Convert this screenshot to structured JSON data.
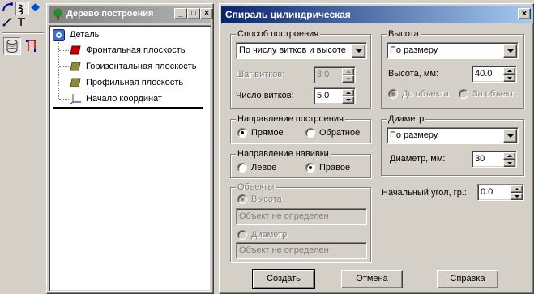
{
  "tree_panel": {
    "title": "Дерево построения",
    "root": "Деталь",
    "items": [
      {
        "label": "Фронтальная плоскость",
        "color": "#c00000"
      },
      {
        "label": "Горизонтальная плоскость",
        "color": "#8b8b38"
      },
      {
        "label": "Профильная плоскость",
        "color": "#8b8b38"
      },
      {
        "label": "Начало координат"
      }
    ]
  },
  "dialog": {
    "title": "Спираль цилиндрическая",
    "close_glyph": "×",
    "construction_method": {
      "label": "Способ построения",
      "selected": "По числу витков и высоте",
      "step_label": "Шаг витков:",
      "step_value": "8.0",
      "turns_label": "Число витков:",
      "turns_value": "5.0"
    },
    "height": {
      "label": "Высота",
      "selected": "По размеру",
      "value_label": "Высота, мм:",
      "value": "40.0",
      "to_object": "До объекта",
      "past_object": "За объект"
    },
    "build_direction": {
      "label": "Направление построения",
      "forward": "Прямое",
      "reverse": "Обратное"
    },
    "diameter": {
      "label": "Диаметр",
      "selected": "По размеру",
      "value_label": "Диаметр, мм:",
      "value": "30"
    },
    "winding_direction": {
      "label": "Направление навивки",
      "left": "Левое",
      "right": "Правое"
    },
    "objects": {
      "label": "Объекты",
      "height_option": "Высота",
      "height_object": "Объект не определен",
      "diameter_option": "Диаметр",
      "diameter_object": "Объект не определен"
    },
    "start_angle": {
      "label": "Начальный угол, гр.:",
      "value": "0.0"
    },
    "buttons": {
      "create": "Создать",
      "cancel": "Отмена",
      "help": "Справка"
    }
  },
  "toolbar_icons": [
    "curve-icon",
    "spiral-icon",
    "surface-icon",
    "line-icon",
    "sketch-icon",
    "cylinder-icon",
    "frame-icon"
  ]
}
